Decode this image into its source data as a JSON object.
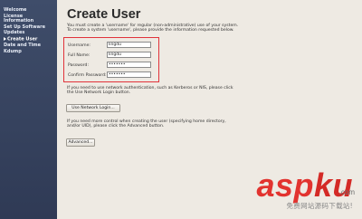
{
  "sidebar": {
    "items": [
      {
        "label": "Welcome",
        "active": false
      },
      {
        "label": "License\nInformation",
        "active": false
      },
      {
        "label": "Set Up Software\nUpdates",
        "active": false
      },
      {
        "label": "Create User",
        "active": true
      },
      {
        "label": "Date and Time",
        "active": false
      },
      {
        "label": "Kdump",
        "active": false
      }
    ]
  },
  "page": {
    "title": "Create User",
    "intro": "You must create a 'username' for regular (non-administrative) use of your system. To create a system 'username', please provide the information requested below."
  },
  "form": {
    "username_label": "Username:",
    "username_value": "lingdu",
    "fullname_label": "Full Name:",
    "fullname_value": "lingdu",
    "password_label": "Password:",
    "password_value": "•••••••",
    "confirm_label": "Confirm Password:",
    "confirm_value": "•••••••"
  },
  "network": {
    "text": "If you need to use network authentication, such as Kerberos or NIS, please click the Use Network Login button.",
    "button_label": "Use Network Login..."
  },
  "advanced": {
    "text": "If you need more control when creating the user (specifying home directory, and/or UID), please click the Advanced button.",
    "button_label": "Advanced..."
  },
  "watermark": {
    "logo_a": "asp",
    "logo_b": "ku",
    "com": ".com",
    "sub": "免费网站源码下载站!"
  }
}
